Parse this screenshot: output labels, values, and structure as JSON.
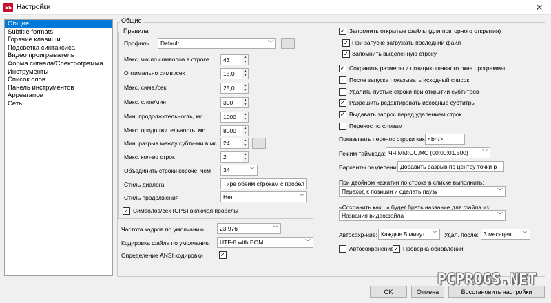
{
  "window": {
    "title": "Настройки",
    "app_icon_text": "SE",
    "close_symbol": "✕"
  },
  "nav": {
    "items": [
      "Общие",
      "Subtitle formats",
      "Горячие клавиши",
      "Подсветка синтаксиса",
      "Видео проигрыватель",
      "Форма сигнала/Спектрограмма",
      "Инструменты",
      "Список слов",
      "Панель инструментов",
      "Appearance",
      "Сеть"
    ],
    "selected_index": 0
  },
  "general": {
    "legend": "Общие",
    "rules": {
      "legend": "Правила",
      "profile_label": "Профиль",
      "profile_value": "Default",
      "profile_button": "...",
      "max_chars_label": "Макс. число символов в строке",
      "max_chars_value": "43",
      "optimal_cps_label": "Оптимально симв./сек",
      "optimal_cps_value": "15,0",
      "max_cps_label": "Макс. симв./сек",
      "max_cps_value": "25,0",
      "max_wpm_label": "Макс. слов/мин",
      "max_wpm_value": "300",
      "min_duration_label": "Мин. продолжительность, мс",
      "min_duration_value": "1000",
      "max_duration_label": "Макс. продолжительность, мс",
      "max_duration_value": "8000",
      "min_gap_label": "Мин. разрыв между субти-ми в мс",
      "min_gap_value": "24",
      "min_gap_button": "...",
      "max_lines_label": "Макс. кол-во строк",
      "max_lines_value": "2",
      "merge_shorter_label": "Объединить строки короче, чем",
      "merge_shorter_value": "34",
      "dialog_style_label": "Стиль диалога",
      "dialog_style_value": "Тире обеим строкам с пробел",
      "continuation_style_label": "Стиль продолжения",
      "continuation_style_value": "Нет",
      "cps_spaces_label": "Символов/сек (CPS) включая пробелы",
      "cps_spaces_checked": true
    },
    "framerate_label": "Частота кадров по умолчанию",
    "framerate_value": "23,976",
    "encoding_label": "Кодировка файла по умолчанию",
    "encoding_value": "UTF-8 with BOM",
    "ansi_detect_label": "Определение ANSI кодировки",
    "ansi_detect_checked": true
  },
  "right": {
    "checkboxes": [
      {
        "label": "Запомнить открытые файлы (для повторного открытия)",
        "checked": true
      },
      {
        "label": "При запуске загружать последний файл",
        "checked": true
      },
      {
        "label": "Запомнить выделенную строку",
        "checked": true
      },
      {
        "label": "Сохранить размеры и позицию главного окна программы",
        "checked": true
      },
      {
        "label": "После запуска показывать исходный список",
        "checked": false
      },
      {
        "label": "Удалить пустые строки при открытии субтитров",
        "checked": false
      },
      {
        "label": "Разрешить редактировать исходные субтитры",
        "checked": true
      },
      {
        "label": "Выдавать запрос перед удалением строк",
        "checked": true
      },
      {
        "label": "Перенос по словам",
        "checked": false
      }
    ],
    "line_break_label": "Показывать перенос строки как:",
    "line_break_value": "<br />",
    "timecode_label": "Режим таймкода:",
    "timecode_value": "ЧЧ:ММ:СС.МС (00:00:01.500)",
    "split_label": "Варианты разделения",
    "split_value": "Добавить разрыв по центру точки р",
    "dblclick_label": "При двойном нажатии по строке в списке выполнить:",
    "dblclick_value": "Переход к позиции и сделать паузу",
    "saveas_label": "«Сохранить как...» будет брать название для файла из:",
    "saveas_value": "Названия видеофайла",
    "autobackup_label": "Автосохр-ние:",
    "autobackup_value": "Каждые 5 минут",
    "delete_after_label": "Удал. после:",
    "delete_after_value": "3 месяцев",
    "autosave_label": "Автосохранение",
    "autosave_checked": false,
    "check_updates_label": "Проверка обновлений",
    "check_updates_checked": true
  },
  "footer": {
    "ok_label": "OK",
    "cancel_label": "Отмена",
    "restore_label": "Восстановить настройки"
  },
  "watermark": "PCPROGS.NET",
  "icons": {
    "chevron": "﹀",
    "spin_up": "▲",
    "spin_down": "▼",
    "check": "✓"
  }
}
